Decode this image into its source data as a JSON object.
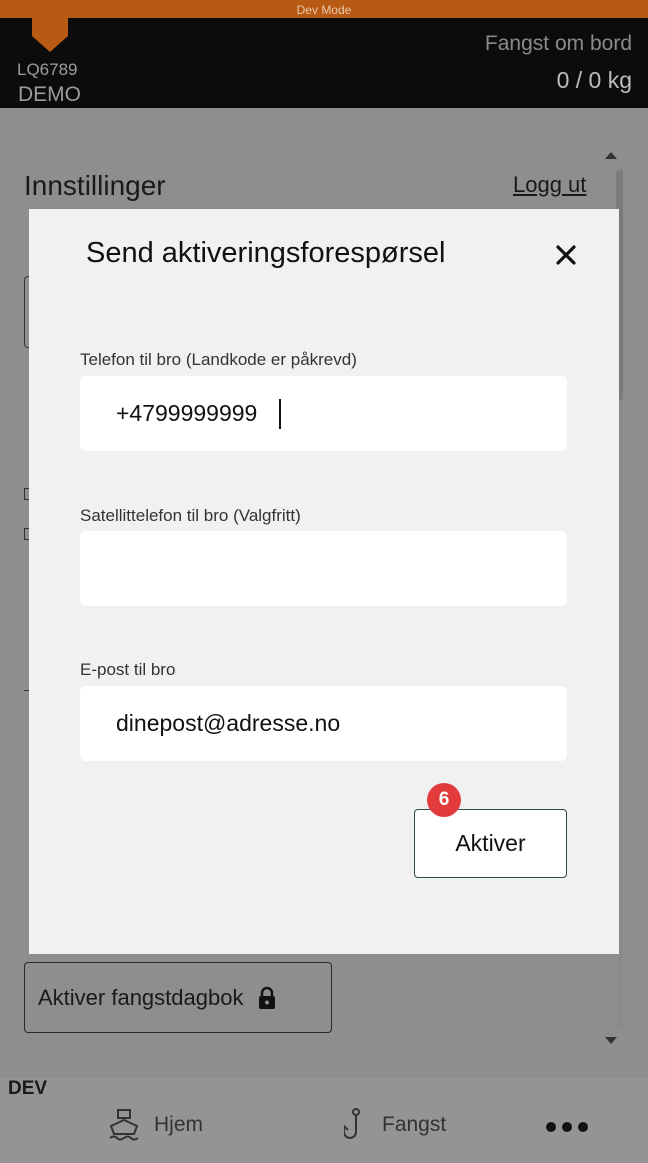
{
  "dev_banner": "Dev Mode",
  "header": {
    "callsign": "LQ6789",
    "vessel": "DEMO",
    "catch_label": "Fangst om bord",
    "catch_value": "0 / 0 kg"
  },
  "page": {
    "title": "Innstillinger",
    "logout": "Logg ut",
    "activate_logbook": "Aktiver fangstdagbok"
  },
  "modal": {
    "title": "Send aktiveringsforespørsel",
    "phone_label": "Telefon til bro (Landkode er påkrevd)",
    "phone_value": "+4799999999",
    "sat_label": "Satellittelefon til bro (Valgfritt)",
    "sat_value": "",
    "email_label": "E-post til bro",
    "email_value": "dinepost@adresse.no",
    "submit_label": "Aktiver",
    "step_badge": "6"
  },
  "bottom_nav": {
    "env": "DEV",
    "home": "Hjem",
    "catch": "Fangst"
  },
  "colors": {
    "banner": "#b85a14",
    "badge": "#e23b3b"
  }
}
